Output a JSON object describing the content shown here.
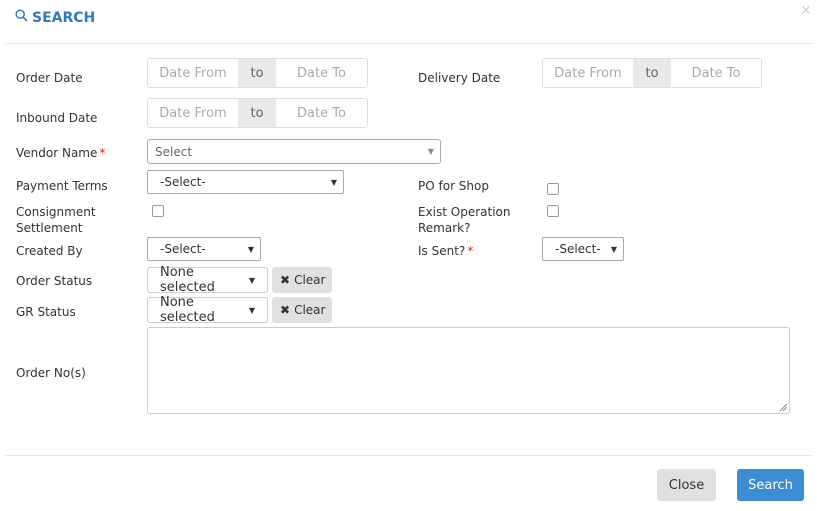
{
  "modal": {
    "title": "SEARCH",
    "close_glyph": "×",
    "icons": {
      "title": "search-icon",
      "close": "close-icon"
    }
  },
  "colors": {
    "title": "#337ab7",
    "primary_button": "#3c8dd4",
    "required": "#e02424",
    "addon": "#e9e9e9",
    "secondary_button": "#e0e0e0"
  },
  "form": {
    "order_date": {
      "label": "Order Date",
      "from_placeholder": "Date From",
      "addon": "to",
      "to_placeholder": "Date To"
    },
    "delivery_date": {
      "label": "Delivery Date",
      "from_placeholder": "Date From",
      "addon": "to",
      "to_placeholder": "Date To"
    },
    "inbound_date": {
      "label": "Inbound Date",
      "from_placeholder": "Date From",
      "addon": "to",
      "to_placeholder": "Date To"
    },
    "vendor_name": {
      "label": "Vendor Name",
      "required_mark": "*",
      "value": "Select"
    },
    "payment_terms": {
      "label": "Payment Terms",
      "value": "-Select-"
    },
    "po_for_shop": {
      "label": "PO for Shop",
      "checked": false
    },
    "consignment_settlement": {
      "label_line1": "Consignment",
      "label_line2": "Settlement",
      "checked": false
    },
    "exist_operation_remark": {
      "label_line1": "Exist Operation",
      "label_line2": "Remark?",
      "checked": false
    },
    "created_by": {
      "label": "Created By",
      "value": "-Select-"
    },
    "is_sent": {
      "label": "Is Sent?",
      "required_mark": "*",
      "value": "-Select-"
    },
    "order_status": {
      "label": "Order Status",
      "value": "None selected",
      "clear_label": "Clear"
    },
    "gr_status": {
      "label": "GR Status",
      "value": "None selected",
      "clear_label": "Clear"
    },
    "order_nos": {
      "label": "Order No(s)",
      "value": ""
    }
  },
  "footer": {
    "close_label": "Close",
    "search_label": "Search"
  }
}
